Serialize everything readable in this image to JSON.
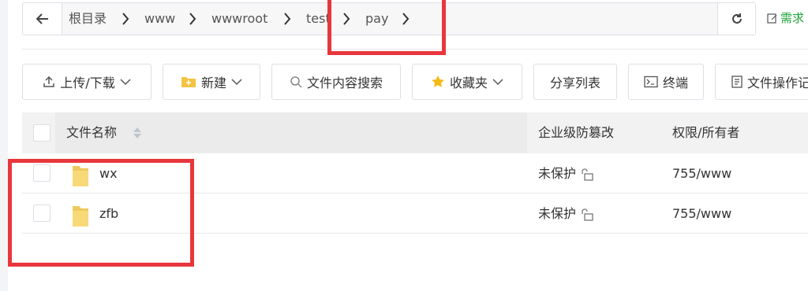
{
  "breadcrumb": {
    "items": [
      "根目录",
      "www",
      "wwwroot",
      "test",
      "pay"
    ]
  },
  "need_link": "需求",
  "toolbar": {
    "upload": "上传/下载",
    "new": "新建",
    "search": "文件内容搜索",
    "favorites": "收藏夹",
    "share_list": "分享列表",
    "terminal": "终端",
    "file_ops": "文件操作记录"
  },
  "table": {
    "columns": [
      "文件名称",
      "企业级防篡改",
      "权限/所有者"
    ],
    "rows": [
      {
        "name": "wx",
        "protect": "未保护",
        "perm": "755/www"
      },
      {
        "name": "zfb",
        "protect": "未保护",
        "perm": "755/www"
      }
    ]
  },
  "colors": {
    "accent": "#20a53a",
    "highlight": "#e8373c",
    "folder": "#f5d374"
  }
}
